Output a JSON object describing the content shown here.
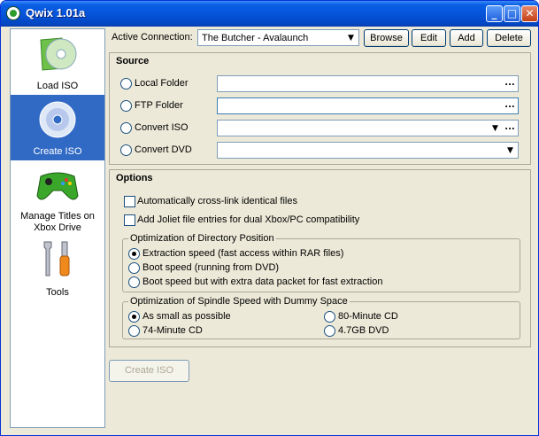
{
  "window": {
    "title": "Qwix 1.01a",
    "controls": {
      "minimize": "_",
      "maximize": "□",
      "close": "✕"
    }
  },
  "sidebar": {
    "items": [
      {
        "label": "Load ISO",
        "icon": "disc-icon",
        "active": false
      },
      {
        "label": "Create ISO",
        "icon": "cd-icon",
        "active": true
      },
      {
        "label": "Manage Titles on Xbox Drive",
        "icon": "gamepad-icon",
        "active": false
      },
      {
        "label": "Tools",
        "icon": "tools-icon",
        "active": false
      }
    ]
  },
  "connection": {
    "label": "Active Connection:",
    "value": "The Butcher - Avalaunch",
    "buttons": {
      "browse": "Browse",
      "edit": "Edit",
      "add": "Add",
      "delete": "Delete"
    }
  },
  "source": {
    "title": "Source",
    "options": [
      {
        "label": "Local Folder",
        "value": "",
        "button": "..."
      },
      {
        "label": "FTP Folder",
        "value": "",
        "button": "..."
      },
      {
        "label": "Convert ISO",
        "value": "",
        "button": "..."
      },
      {
        "label": "Convert DVD",
        "value": ""
      }
    ]
  },
  "options": {
    "title": "Options",
    "checkboxes": [
      {
        "label": "Automatically cross-link identical files",
        "checked": false
      },
      {
        "label": "Add Joliet file entries for dual Xbox/PC compatibility",
        "checked": false
      }
    ],
    "directory_position": {
      "title": "Optimization of Directory Position",
      "choices": [
        {
          "label": "Extraction speed (fast access within RAR files)",
          "selected": true
        },
        {
          "label": "Boot speed (running from DVD)",
          "selected": false
        },
        {
          "label": "Boot speed but with extra data packet for fast extraction",
          "selected": false
        }
      ]
    },
    "spindle_speed": {
      "title": "Optimization of Spindle Speed with Dummy Space",
      "choices": [
        {
          "label": "As small as possible",
          "selected": true
        },
        {
          "label": "80-Minute CD",
          "selected": false
        },
        {
          "label": "74-Minute CD",
          "selected": false
        },
        {
          "label": "4.7GB DVD",
          "selected": false
        }
      ]
    }
  },
  "footer": {
    "create_button": "Create ISO"
  }
}
